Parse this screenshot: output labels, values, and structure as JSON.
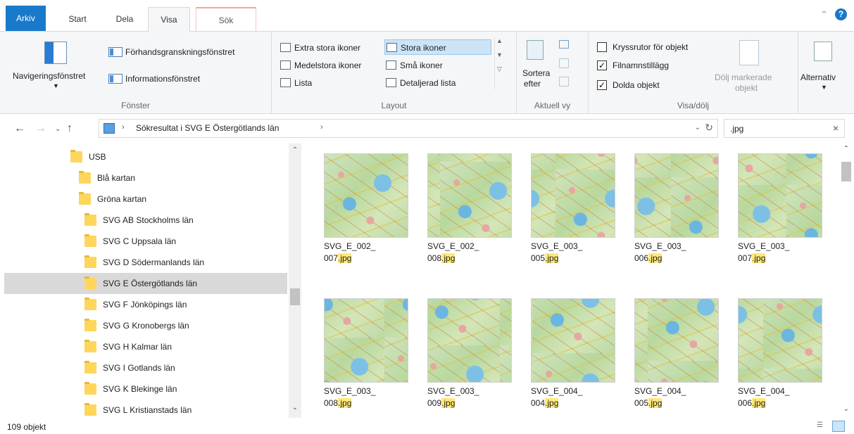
{
  "tabs": {
    "file": "Arkiv",
    "start": "Start",
    "dela": "Dela",
    "visa": "Visa",
    "sok": "Sök"
  },
  "ribbon": {
    "fonster": {
      "label": "Fönster",
      "navpane": "Navigeringsfönstret",
      "preview": "Förhandsgranskningsfönstret",
      "details": "Informationsfönstret"
    },
    "layout": {
      "label": "Layout",
      "items": [
        "Extra stora ikoner",
        "Stora ikoner",
        "Medelstora ikoner",
        "Små ikoner",
        "Lista",
        "Detaljerad lista"
      ]
    },
    "aktuell": {
      "label": "Aktuell vy",
      "sort": "Sortera",
      "sort2": "efter"
    },
    "visadolj": {
      "label": "Visa/dölj",
      "checkboxes": [
        {
          "label": "Kryssrutor för objekt",
          "checked": false
        },
        {
          "label": "Filnamnstillägg",
          "checked": true
        },
        {
          "label": "Dolda objekt",
          "checked": true
        }
      ],
      "hide_selected_1": "Dölj markerade",
      "hide_selected_2": "objekt"
    },
    "alt": {
      "label": "Alternativ"
    }
  },
  "address": {
    "path": "Sökresultat i SVG E Östergötlands län",
    "search_value": ".jpg"
  },
  "tree": [
    {
      "label": "USB",
      "indent": 0
    },
    {
      "label": "Blå kartan",
      "indent": 1
    },
    {
      "label": "Gröna kartan",
      "indent": 1
    },
    {
      "label": "SVG AB Stockholms län",
      "indent": 2
    },
    {
      "label": "SVG C Uppsala län",
      "indent": 2
    },
    {
      "label": "SVG D Södermanlands län",
      "indent": 2
    },
    {
      "label": "SVG E Östergötlands län",
      "indent": 2,
      "selected": true
    },
    {
      "label": "SVG F Jönköpings län",
      "indent": 2
    },
    {
      "label": "SVG G Kronobergs län",
      "indent": 2
    },
    {
      "label": "SVG H Kalmar län",
      "indent": 2
    },
    {
      "label": "SVG I Gotlands län",
      "indent": 2
    },
    {
      "label": "SVG K Blekinge län",
      "indent": 2
    },
    {
      "label": "SVG L Kristianstads län",
      "indent": 2
    }
  ],
  "files": [
    {
      "line1": "SVG_E_002_",
      "line2": "007",
      "ext": ".jpg"
    },
    {
      "line1": "SVG_E_002_",
      "line2": "008",
      "ext": ".jpg"
    },
    {
      "line1": "SVG_E_003_",
      "line2": "005",
      "ext": ".jpg"
    },
    {
      "line1": "SVG_E_003_",
      "line2": "006",
      "ext": ".jpg"
    },
    {
      "line1": "SVG_E_003_",
      "line2": "007",
      "ext": ".jpg"
    },
    {
      "line1": "SVG_E_003_",
      "line2": "008",
      "ext": ".jpg"
    },
    {
      "line1": "SVG_E_003_",
      "line2": "009",
      "ext": ".jpg"
    },
    {
      "line1": "SVG_E_004_",
      "line2": "004",
      "ext": ".jpg"
    },
    {
      "line1": "SVG_E_004_",
      "line2": "005",
      "ext": ".jpg"
    },
    {
      "line1": "SVG_E_004_",
      "line2": "006",
      "ext": ".jpg"
    }
  ],
  "status": {
    "count": "109 objekt"
  },
  "colors": {
    "accent": "#1979ca",
    "highlight": "#ffe97a",
    "selection": "#cce4f7"
  }
}
